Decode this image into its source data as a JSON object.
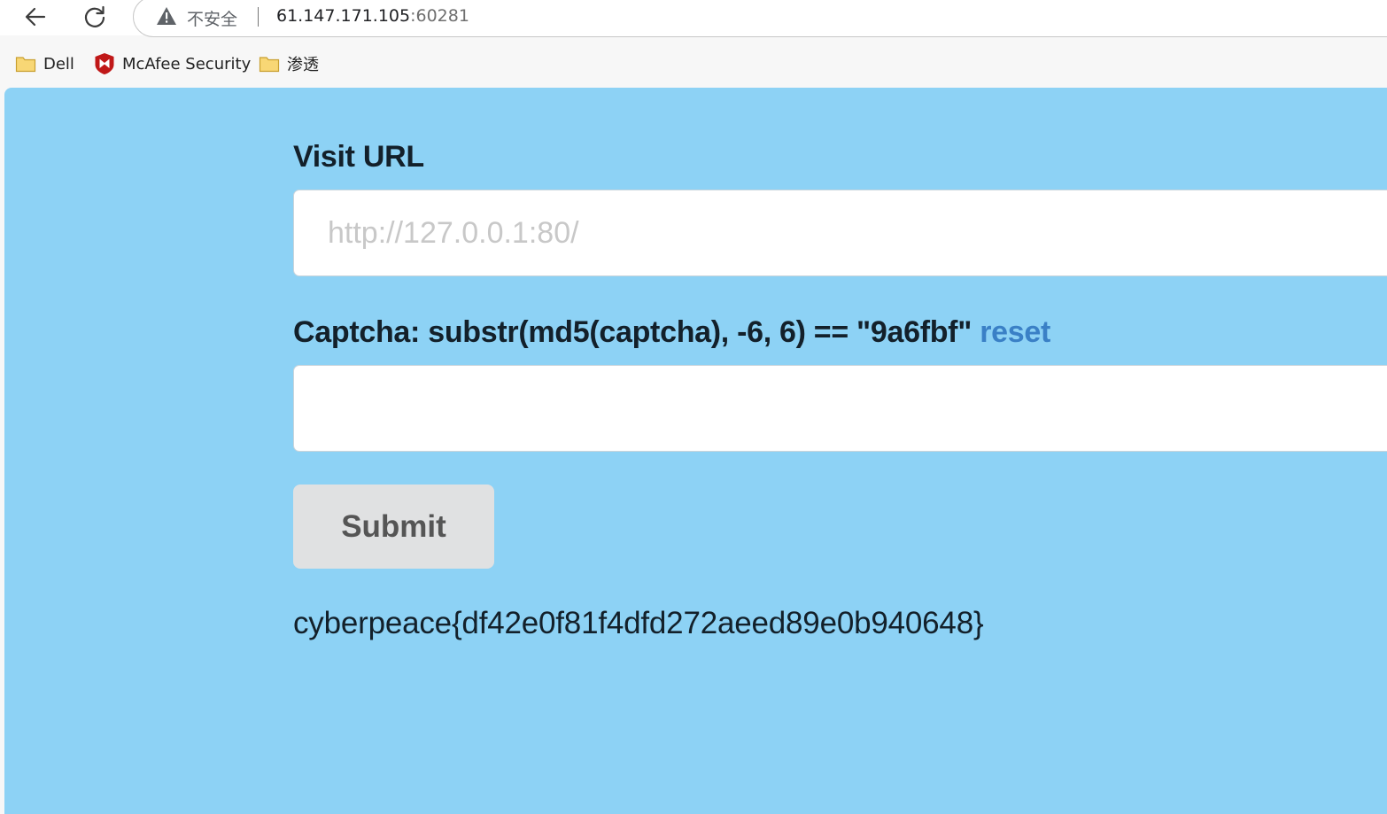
{
  "browser": {
    "back_icon": "arrow-left-icon",
    "reload_icon": "reload-icon",
    "address_bar": {
      "warning_icon": "warning-triangle-icon",
      "security_label": "不安全",
      "host": "61.147.171.105",
      "port": ":60281"
    },
    "bookmarks": [
      {
        "label": "Dell",
        "icon": "folder-icon"
      },
      {
        "label": "McAfee Security",
        "icon": "mcafee-shield-icon"
      },
      {
        "label": "渗透",
        "icon": "folder-icon"
      }
    ]
  },
  "form": {
    "visit_label": "Visit URL",
    "url_input": {
      "value": "",
      "placeholder": "http://127.0.0.1:80/"
    },
    "captcha_label": "Captcha: substr(md5(captcha), -6, 6) == \"9a6fbf\"",
    "reset_link": "reset",
    "captcha_input": {
      "value": "",
      "placeholder": ""
    },
    "submit_label": "Submit",
    "result_text": "cyberpeace{df42e0f81f4dfd272aeed89e0b940648}"
  },
  "colors": {
    "page_background": "#8dd2f5",
    "link": "#3a80c6",
    "button_background": "#e0e1e2"
  }
}
